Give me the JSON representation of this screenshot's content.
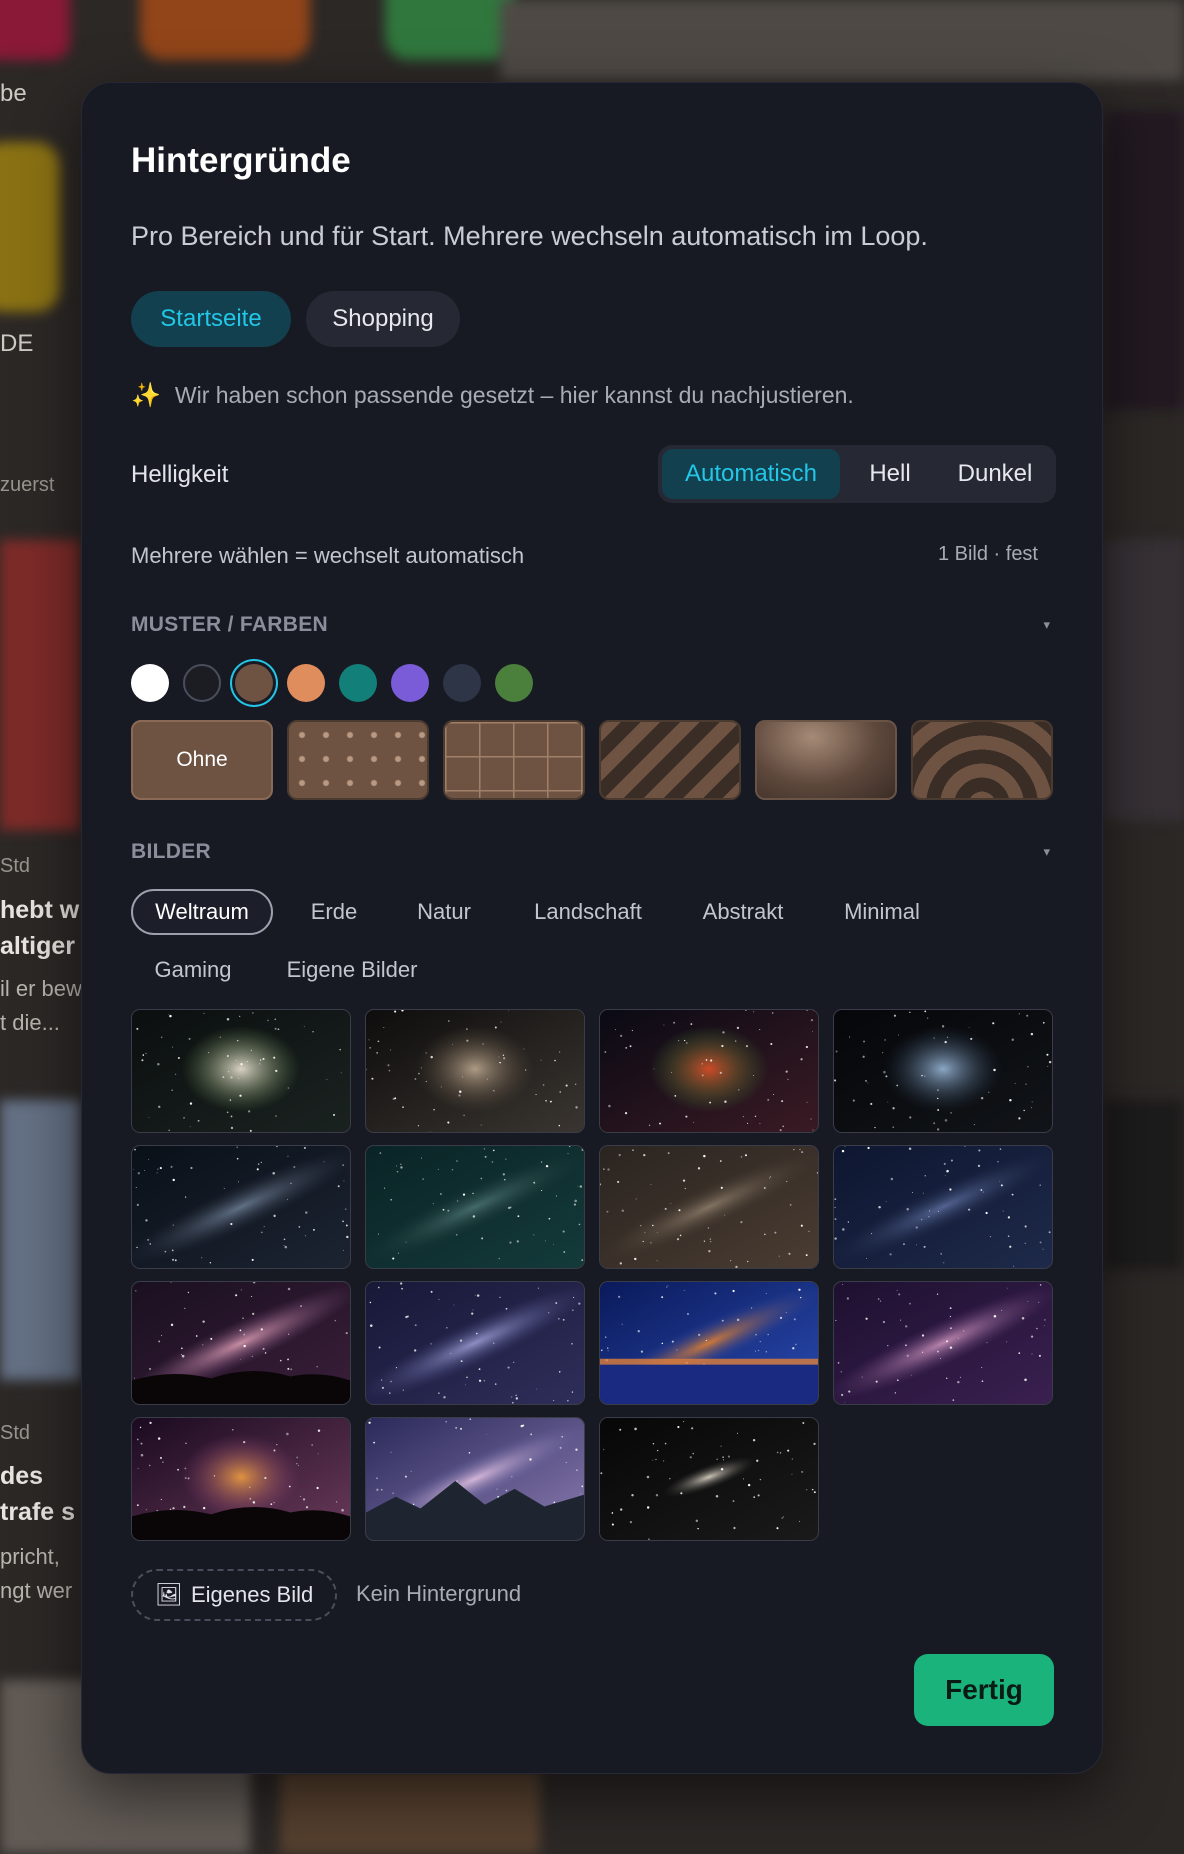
{
  "background_app": {
    "snippets": [
      "be",
      "DE",
      "zuerst",
      "Std",
      "hebt w",
      "altiger N",
      "il er bew",
      "t die...",
      "Std",
      "des",
      "trafe s",
      "pricht,",
      "ngt wer"
    ]
  },
  "modal": {
    "title": "Hintergründe",
    "subtitle": "Pro Bereich und für Start. Mehrere wechseln automatisch im Loop.",
    "tabs": [
      {
        "label": "Startseite",
        "active": true
      },
      {
        "label": "Shopping",
        "active": false
      }
    ],
    "hint_icon": "sparkle-icon",
    "hint": "Wir haben schon passende gesetzt – hier kannst du nachjustieren.",
    "brightness": {
      "label": "Helligkeit",
      "options": [
        {
          "label": "Automatisch",
          "active": true
        },
        {
          "label": "Hell",
          "active": false
        },
        {
          "label": "Dunkel",
          "active": false
        }
      ]
    },
    "multi_label": "Mehrere wählen = wechselt automatisch",
    "multi_count": "1 Bild · fest",
    "patterns_section": {
      "title": "MUSTER / FARBEN",
      "caret": "▾",
      "swatches": [
        {
          "color": "#ffffff",
          "selected": false
        },
        {
          "color": "#1b1d22",
          "selected": false
        },
        {
          "color": "#6e5242",
          "selected": true
        },
        {
          "color": "#e08d5e",
          "selected": false
        },
        {
          "color": "#127f78",
          "selected": false
        },
        {
          "color": "#7a5cd8",
          "selected": false
        },
        {
          "color": "#2d3546",
          "selected": false
        },
        {
          "color": "#4a7f3c",
          "selected": false
        }
      ],
      "patterns": [
        {
          "label": "Ohne",
          "kind": "plain"
        },
        {
          "label": "",
          "kind": "dots"
        },
        {
          "label": "",
          "kind": "grid"
        },
        {
          "label": "",
          "kind": "stripes"
        },
        {
          "label": "",
          "kind": "gradient"
        },
        {
          "label": "",
          "kind": "waves"
        }
      ]
    },
    "images_section": {
      "title": "BILDER",
      "caret": "▾",
      "categories": [
        {
          "label": "Weltraum",
          "active": true
        },
        {
          "label": "Erde",
          "active": false
        },
        {
          "label": "Natur",
          "active": false
        },
        {
          "label": "Landschaft",
          "active": false
        },
        {
          "label": "Abstrakt",
          "active": false
        },
        {
          "label": "Minimal",
          "active": false
        },
        {
          "label": "Gaming",
          "active": false
        },
        {
          "label": "Eigene Bilder",
          "active": false
        }
      ],
      "thumbnail_count": 15
    },
    "own_image_icon": "picture-frame-icon",
    "own_image_button": "Eigenes Bild",
    "no_background_button": "Kein Hintergrund",
    "done_button": "Fertig"
  },
  "colors": {
    "accent": "#23c6e6",
    "accent_bg": "#12404e",
    "done": "#1ab37c",
    "modal_bg": "#181a23",
    "brown": "#6e5242"
  }
}
